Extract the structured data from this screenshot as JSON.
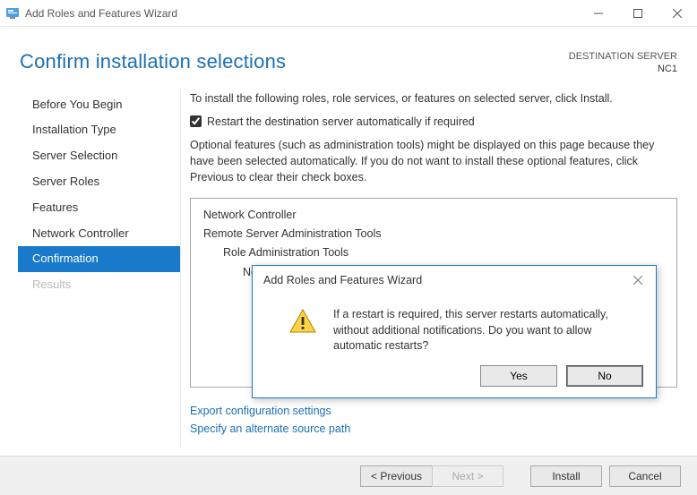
{
  "titlebar": {
    "title": "Add Roles and Features Wizard"
  },
  "page": {
    "heading": "Confirm installation selections",
    "destination_label": "DESTINATION SERVER",
    "destination_name": "NC1"
  },
  "sidebar": {
    "items": [
      {
        "label": "Before You Begin",
        "state": "normal"
      },
      {
        "label": "Installation Type",
        "state": "normal"
      },
      {
        "label": "Server Selection",
        "state": "normal"
      },
      {
        "label": "Server Roles",
        "state": "normal"
      },
      {
        "label": "Features",
        "state": "normal"
      },
      {
        "label": "Network Controller",
        "state": "normal"
      },
      {
        "label": "Confirmation",
        "state": "selected"
      },
      {
        "label": "Results",
        "state": "disabled"
      }
    ]
  },
  "main": {
    "intro": "To install the following roles, role services, or features on selected server, click Install.",
    "restart_checkbox_label": "Restart the destination server automatically if required",
    "restart_checked": true,
    "optional_text": "Optional features (such as administration tools) might be displayed on this page because they have been selected automatically. If you do not want to install these optional features, click Previous to clear their check boxes.",
    "summary": [
      {
        "text": "Network Controller",
        "level": 0
      },
      {
        "text": "Remote Server Administration Tools",
        "level": 0
      },
      {
        "text": "Role Administration Tools",
        "level": 1
      },
      {
        "text": "Network Controller Management Tools",
        "level": 2
      }
    ],
    "links": {
      "export": "Export configuration settings",
      "source": "Specify an alternate source path"
    }
  },
  "footer": {
    "previous": "< Previous",
    "next": "Next >",
    "install": "Install",
    "cancel": "Cancel"
  },
  "modal": {
    "title": "Add Roles and Features Wizard",
    "message": "If a restart is required, this server restarts automatically, without additional notifications. Do you want to allow automatic restarts?",
    "yes": "Yes",
    "no": "No"
  }
}
